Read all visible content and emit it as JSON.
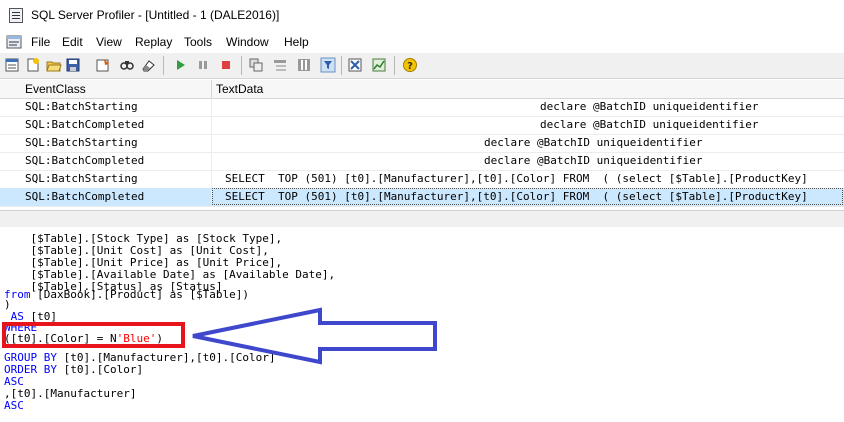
{
  "window": {
    "title": "SQL Server Profiler - [Untitled - 1 (DALE2016)]"
  },
  "menu": [
    "File",
    "Edit",
    "View",
    "Replay",
    "Tools",
    "Window",
    "Help"
  ],
  "toolbar": {
    "icons": [
      "new-trace-icon",
      "new-template-icon",
      "open-icon",
      "save-icon",
      "properties-icon",
      "find-icon",
      "clear-icon",
      "start-icon",
      "pause-icon",
      "stop-icon",
      "auto-scroll-icon",
      "group-icon",
      "column-icon",
      "filter-icon",
      "tuning-advisor-icon",
      "perfmon-icon",
      "help-icon"
    ]
  },
  "grid": {
    "columns": [
      "EventClass",
      "TextData"
    ],
    "rows": [
      {
        "event": "SQL:BatchStarting",
        "text": "declare @BatchID uniqueidentifier",
        "selected": false
      },
      {
        "event": "SQL:BatchCompleted",
        "text": "declare @BatchID uniqueidentifier",
        "selected": false
      },
      {
        "event": "SQL:BatchStarting",
        "text": "declare @BatchID uniqueidentifier",
        "selected": false
      },
      {
        "event": "SQL:BatchCompleted",
        "text": "declare @BatchID uniqueidentifier",
        "selected": false
      },
      {
        "event": "SQL:BatchStarting",
        "text": "SELECT  TOP (501) [t0].[Manufacturer],[t0].[Color] FROM  ( (select [$Table].[ProductKey]",
        "selected": false
      },
      {
        "event": "SQL:BatchCompleted",
        "text": "SELECT  TOP (501) [t0].[Manufacturer],[t0].[Color] FROM  ( (select [$Table].[ProductKey]",
        "selected": true
      }
    ]
  },
  "sql": {
    "line1": "    [$Table].[Stock Type] as [Stock Type],",
    "line2": "    [$Table].[Unit Cost] as [Unit Cost],",
    "line3": "    [$Table].[Unit Price] as [Unit Price],",
    "line4": "    [$Table].[Available Date] as [Available Date],",
    "line5": "    [$Table].[Status] as [Status]",
    "line6_kw": "from",
    "line6_rest": " [DaxBook].[Product] as [$Table])",
    "line7": ")",
    "line8_kw": " AS",
    "line8_rest": " [t0]",
    "line9": "WHERE",
    "line10_a": "([t0].[Color] = N",
    "line10_str": "'Blue'",
    "line10_b": ")",
    "line11_kw": "GROUP BY",
    "line11_rest": " [t0].[Manufacturer],[t0].[Color]",
    "line12_kw": "ORDER BY",
    "line12_rest": " [t0].[Color]",
    "line13": "ASC",
    "line14": ",[t0].[Manufacturer]",
    "line15": "ASC"
  },
  "colors": {
    "highlight_box": "#e8141c",
    "arrow": "#3f48cc",
    "selected_row": "#cce8ff"
  }
}
